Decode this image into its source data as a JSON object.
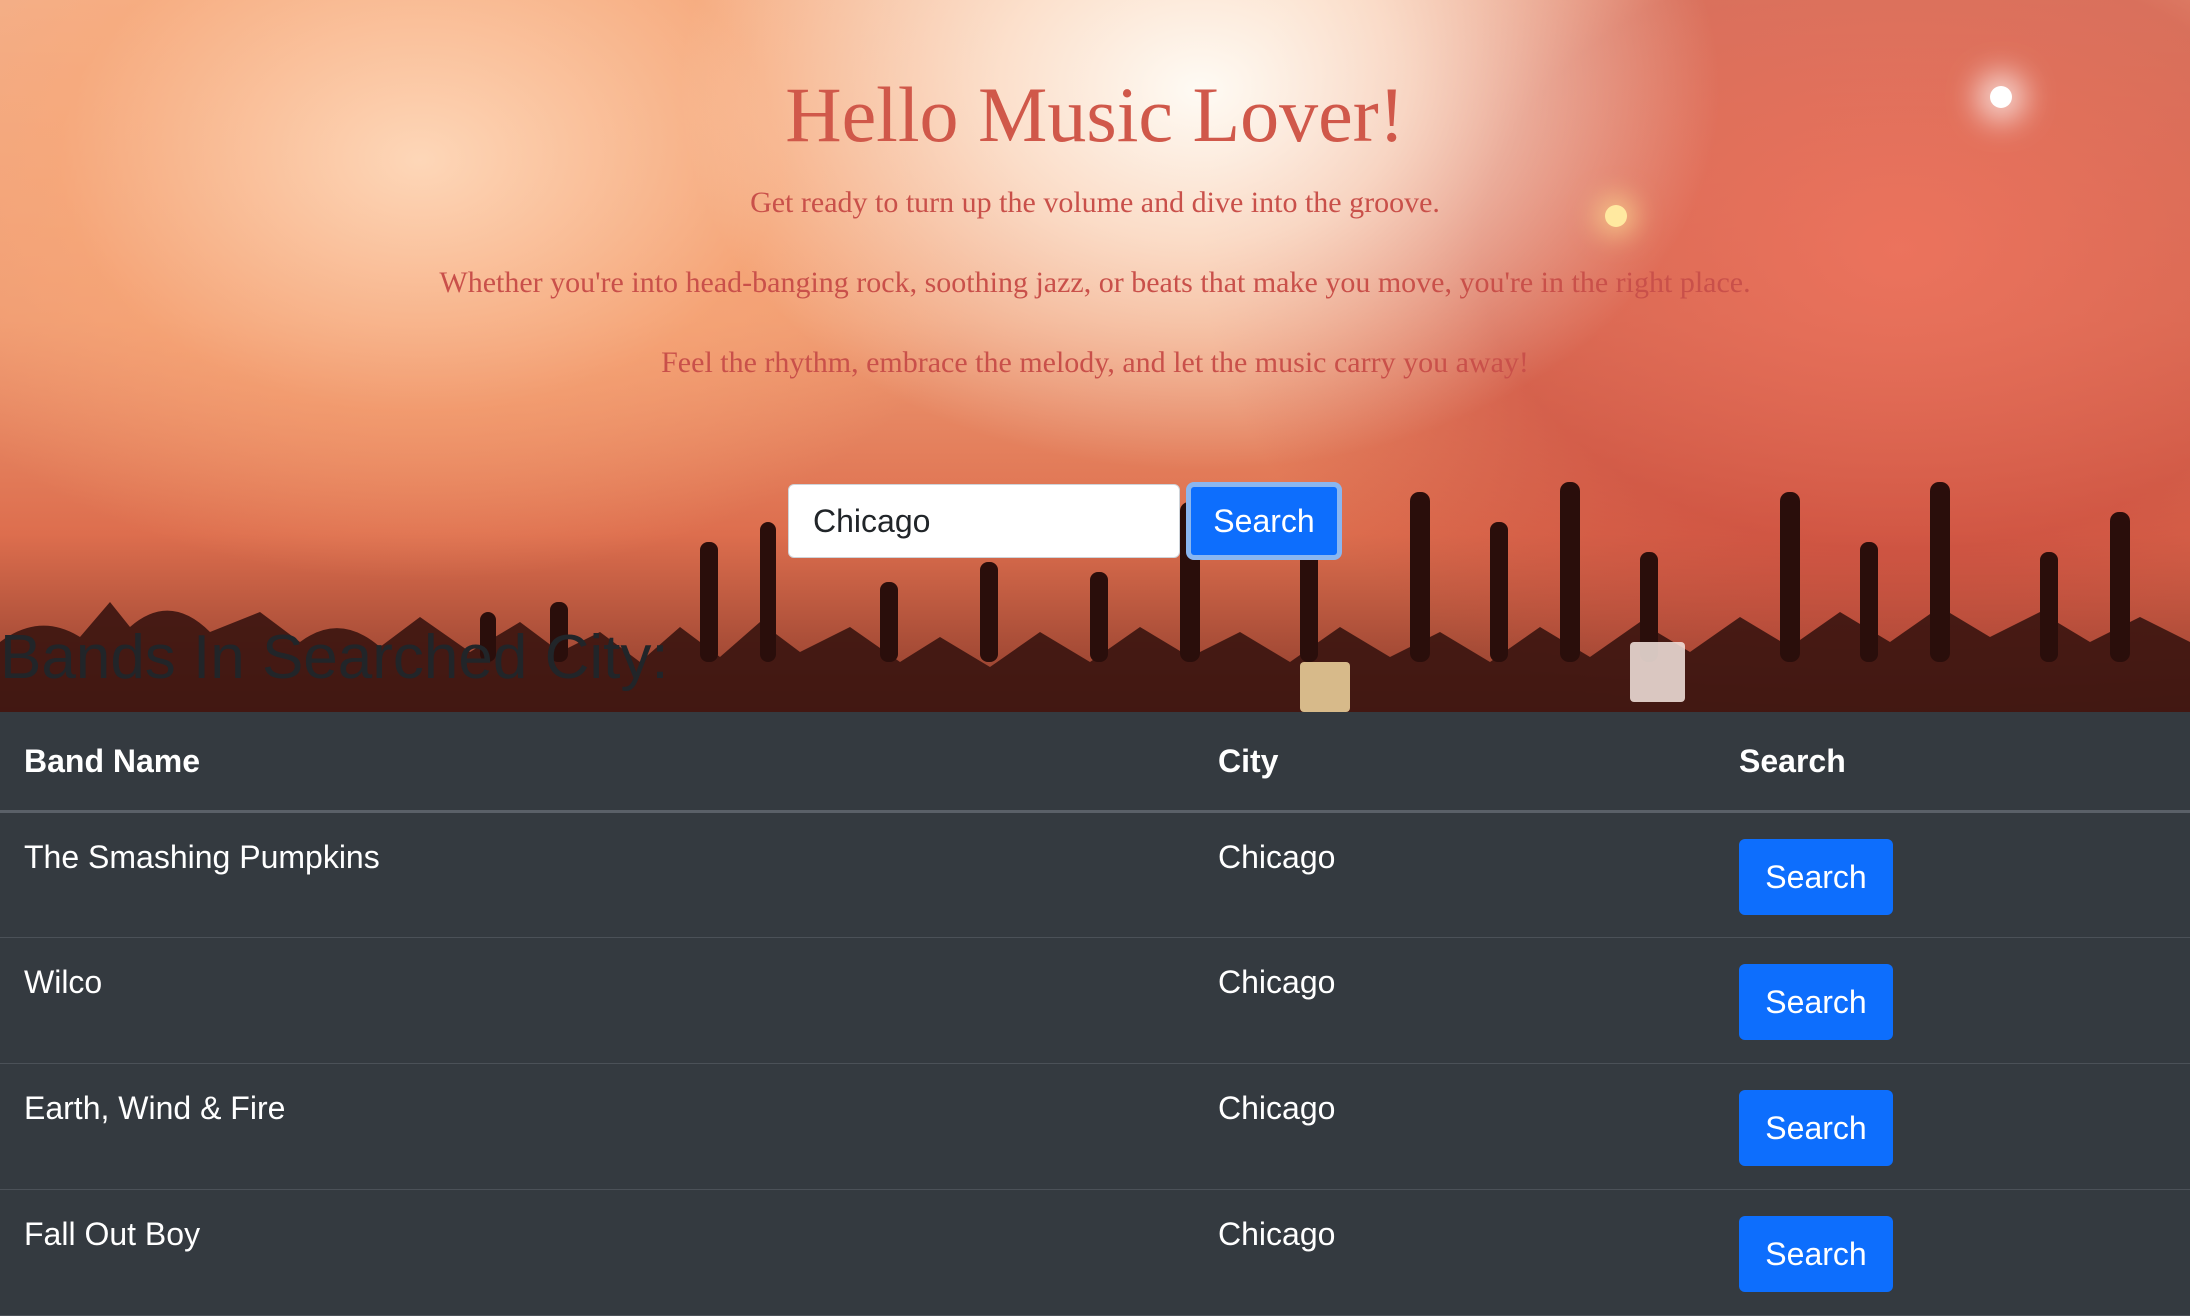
{
  "hero": {
    "title": "Hello Music Lover!",
    "lines": [
      "Get ready to turn up the volume and dive into the groove.",
      "Whether you're into head-banging rock, soothing jazz, or beats that make you move, you're in the right place.",
      "Feel the rhythm, embrace the melody, and let the music carry you away!"
    ]
  },
  "search": {
    "value": "Chicago",
    "button_label": "Search"
  },
  "results": {
    "heading": "Bands In Searched City:",
    "columns": [
      "Band Name",
      "City",
      "Search"
    ],
    "rows": [
      {
        "band": "The Smashing Pumpkins",
        "city": "Chicago",
        "action": "Search"
      },
      {
        "band": "Wilco",
        "city": "Chicago",
        "action": "Search"
      },
      {
        "band": "Earth, Wind & Fire",
        "city": "Chicago",
        "action": "Search"
      },
      {
        "band": "Fall Out Boy",
        "city": "Chicago",
        "action": "Search"
      }
    ]
  },
  "colors": {
    "accent": "#0d6efd",
    "table_bg": "#343a40",
    "hero_text": "#d0584a"
  }
}
